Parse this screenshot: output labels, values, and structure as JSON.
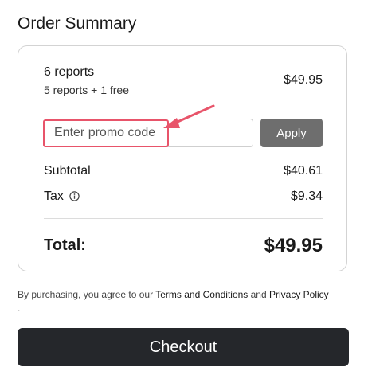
{
  "summary": {
    "title": "Order Summary"
  },
  "product": {
    "name": "6 reports",
    "detail": "5 reports + 1 free",
    "price": "$49.95"
  },
  "promo": {
    "placeholder": "Enter promo code",
    "value": "",
    "apply_label": "Apply"
  },
  "totals": {
    "subtotal_label": "Subtotal",
    "subtotal_value": "$40.61",
    "tax_label": "Tax",
    "tax_value": "$9.34",
    "total_label": "Total:",
    "total_value": "$49.95"
  },
  "legal": {
    "prefix": "By purchasing, you agree to our ",
    "terms_link": "Terms and Conditions ",
    "and_text": " and ",
    "privacy_link": "Privacy Policy",
    "suffix": "."
  },
  "checkout": {
    "label": "Checkout"
  },
  "colors": {
    "annotation": "#e8546a",
    "apply_button": "#6e6e6e",
    "checkout_button": "#25272b"
  },
  "icons": {
    "tax_info": "info-icon",
    "annotation": "annotation-arrow-icon"
  }
}
